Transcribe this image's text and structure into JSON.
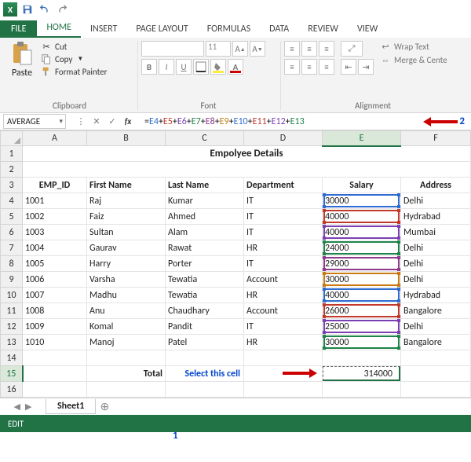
{
  "titlebar": {
    "app": "Excel"
  },
  "tabs": {
    "file": "FILE",
    "home": "HOME",
    "insert": "INSERT",
    "pagelayout": "PAGE LAYOUT",
    "formulas": "FORMULAS",
    "data": "DATA",
    "review": "REVIEW",
    "view": "VIEW"
  },
  "ribbon": {
    "paste": "Paste",
    "cut": "Cut",
    "copy": "Copy",
    "format_painter": "Format Painter",
    "clipboard_label": "Clipboard",
    "font_name": "",
    "font_size": "11",
    "font_label": "Font",
    "wrap": "Wrap Text",
    "merge": "Merge & Cente",
    "align_label": "Alignment"
  },
  "namebox": "AVERAGE",
  "formula": {
    "prefix": "=",
    "refs": [
      {
        "t": "E4",
        "c": "#2d6bd0"
      },
      {
        "t": "E5",
        "c": "#c0392b"
      },
      {
        "t": "E6",
        "c": "#7c3fb3"
      },
      {
        "t": "E7",
        "c": "#1e8449"
      },
      {
        "t": "E8",
        "c": "#8e3b8e"
      },
      {
        "t": "E9",
        "c": "#c97a12"
      },
      {
        "t": "E10",
        "c": "#2d6bd0"
      },
      {
        "t": "E11",
        "c": "#c0392b"
      },
      {
        "t": "E12",
        "c": "#7c3fb3"
      },
      {
        "t": "E13",
        "c": "#1e8449"
      }
    ]
  },
  "annot2": "2",
  "annot1": "1",
  "columns": [
    "A",
    "B",
    "C",
    "D",
    "E",
    "F"
  ],
  "sheet_title": "Empolyee Details",
  "headers": {
    "a": "EMP_ID",
    "b": "First Name",
    "c": "Last Name",
    "d": "Department",
    "e": "Salary",
    "f": "Address"
  },
  "rows": [
    {
      "n": 4,
      "id": "1001",
      "fn": "Raj",
      "ln": "Kumar",
      "dep": "IT",
      "sal": "30000",
      "addr": "Delhi",
      "c": "#2d6bd0"
    },
    {
      "n": 5,
      "id": "1002",
      "fn": "Faiz",
      "ln": "Ahmed",
      "dep": "IT",
      "sal": "40000",
      "addr": "Hydrabad",
      "c": "#c0392b"
    },
    {
      "n": 6,
      "id": "1003",
      "fn": "Sultan",
      "ln": "Alam",
      "dep": "IT",
      "sal": "40000",
      "addr": "Mumbai",
      "c": "#7c3fb3"
    },
    {
      "n": 7,
      "id": "1004",
      "fn": "Gaurav",
      "ln": "Rawat",
      "dep": "HR",
      "sal": "24000",
      "addr": "Delhi",
      "c": "#1e8449"
    },
    {
      "n": 8,
      "id": "1005",
      "fn": "Harry",
      "ln": "Porter",
      "dep": "IT",
      "sal": "29000",
      "addr": "Delhi",
      "c": "#8e3b8e"
    },
    {
      "n": 9,
      "id": "1006",
      "fn": "Varsha",
      "ln": "Tewatia",
      "dep": "Account",
      "sal": "30000",
      "addr": "Delhi",
      "c": "#c97a12"
    },
    {
      "n": 10,
      "id": "1007",
      "fn": "Madhu",
      "ln": "Tewatia",
      "dep": "HR",
      "sal": "40000",
      "addr": "Hydrabad",
      "c": "#2d6bd0"
    },
    {
      "n": 11,
      "id": "1008",
      "fn": "Anu",
      "ln": "Chaudhary",
      "dep": "Account",
      "sal": "26000",
      "addr": "Bangalore",
      "c": "#c0392b"
    },
    {
      "n": 12,
      "id": "1009",
      "fn": "Komal",
      "ln": "Pandit",
      "dep": "IT",
      "sal": "25000",
      "addr": "Delhi",
      "c": "#7c3fb3"
    },
    {
      "n": 13,
      "id": "1010",
      "fn": "Manoj",
      "ln": "Patel",
      "dep": "HR",
      "sal": "30000",
      "addr": "Bangalore",
      "c": "#1e8449"
    }
  ],
  "total_label": "Total",
  "select_label": "Select this cell",
  "total_value": "314000",
  "sheet_tab": "Sheet1",
  "status": "EDIT"
}
